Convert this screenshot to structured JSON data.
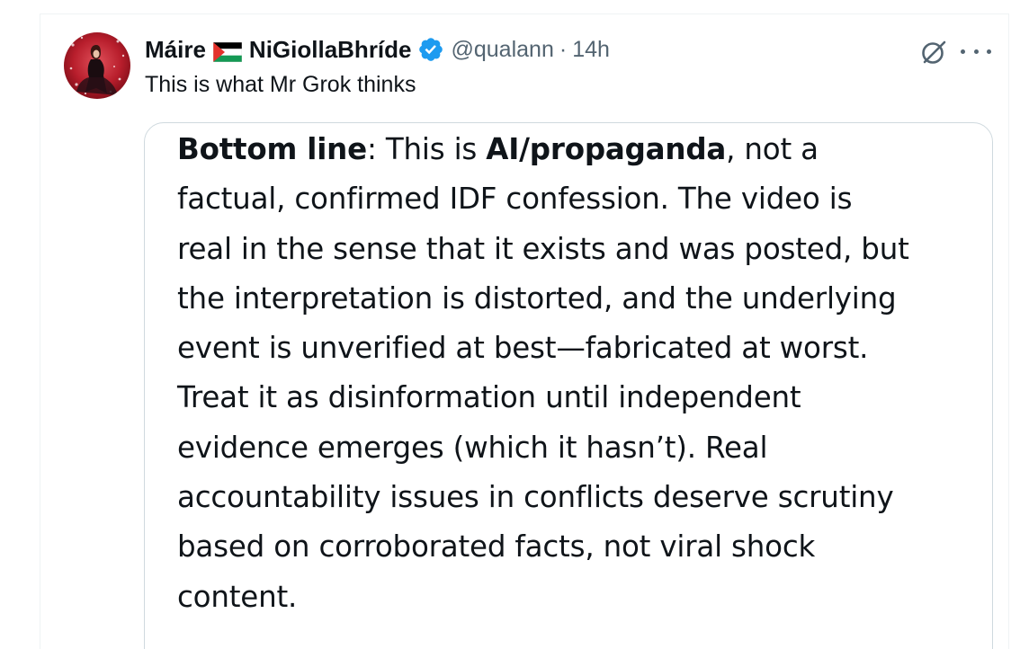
{
  "post": {
    "author": {
      "name_part1": "Máire",
      "flag_icon": "palestine-flag-icon",
      "name_part2": "NiGiollaBhríde",
      "verified_icon": "verified-badge-icon",
      "handle": "@qualann",
      "separator": "·",
      "time": "14h"
    },
    "actions": {
      "grok_icon": "grok-icon",
      "more_icon": "more-options-icon"
    },
    "text": "This is what Mr Grok thinks",
    "media": {
      "lines": [
        [
          {
            "t": "Bottom line",
            "b": true
          },
          {
            "t": ": This is ",
            "b": false
          },
          {
            "t": "AI/propaganda",
            "b": true
          },
          {
            "t": ", not a",
            "b": false
          }
        ],
        [
          {
            "t": "factual, confirmed IDF confession. The video is",
            "b": false
          }
        ],
        [
          {
            "t": "real in the sense that it exists and was posted, but",
            "b": false
          }
        ],
        [
          {
            "t": "the interpretation is distorted, and the underlying",
            "b": false
          }
        ],
        [
          {
            "t": "event is unverified at best—fabricated at worst.",
            "b": false
          }
        ],
        [
          {
            "t": "Treat it as disinformation until independent",
            "b": false
          }
        ],
        [
          {
            "t": "evidence emerges (which it hasn’t). Real",
            "b": false
          }
        ],
        [
          {
            "t": "accountability issues in conflicts deserve scrutiny",
            "b": false
          }
        ],
        [
          {
            "t": "based on corroborated facts, not viral shock",
            "b": false
          }
        ],
        [
          {
            "t": "content.",
            "b": false
          }
        ]
      ]
    }
  },
  "colors": {
    "text": "#0f1419",
    "secondary": "#536471",
    "verified": "#1d9bf0",
    "border": "#cfd9de"
  }
}
